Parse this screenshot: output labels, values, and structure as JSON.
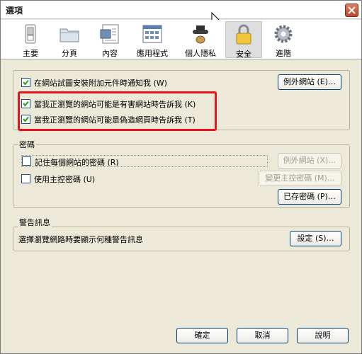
{
  "window": {
    "title": "選項"
  },
  "toolbar": {
    "items": [
      {
        "label": "主要",
        "icon": "main-switch-icon"
      },
      {
        "label": "分頁",
        "icon": "tabs-folder-icon"
      },
      {
        "label": "內容",
        "icon": "content-page-icon"
      },
      {
        "label": "應用程式",
        "icon": "applications-icon"
      },
      {
        "label": "個人隱私",
        "icon": "privacy-mask-icon"
      },
      {
        "label": "安全",
        "icon": "security-lock-icon",
        "selected": true
      },
      {
        "label": "進階",
        "icon": "advanced-gear-icon"
      }
    ]
  },
  "addons": {
    "warn_install_label": "在網站試圖安裝附加元件時通知我 (W)",
    "warn_install_checked": true,
    "exceptions_button": "例外網站 (E)…",
    "attack_site_label": "當我正瀏覽的網站可能是有害網站時告訴我 (K)",
    "attack_site_checked": true,
    "forgery_label": "當我正瀏覽的網站可能是偽造網頁時告訴我 (T)",
    "forgery_checked": true
  },
  "passwords": {
    "title": "密碼",
    "remember_label": "記住每個網站的密碼 (R)",
    "remember_checked": false,
    "exceptions_button": "例外網站 (X)…",
    "master_label": "使用主控密碼 (U)",
    "master_checked": false,
    "change_master_button": "變更主控密碼 (M)…",
    "saved_passwords_button": "已存密碼 (P)…"
  },
  "warnings": {
    "title": "警告訊息",
    "description": "選擇瀏覽網路時要顯示何種警告訊息",
    "settings_button": "設定 (S)…"
  },
  "footer": {
    "ok_button": "確定",
    "cancel_button": "取消",
    "help_button": "說明"
  },
  "colors": {
    "highlight": "#e8141c",
    "dialog_bg": "#ece9d8",
    "button_border": "#003c74"
  }
}
